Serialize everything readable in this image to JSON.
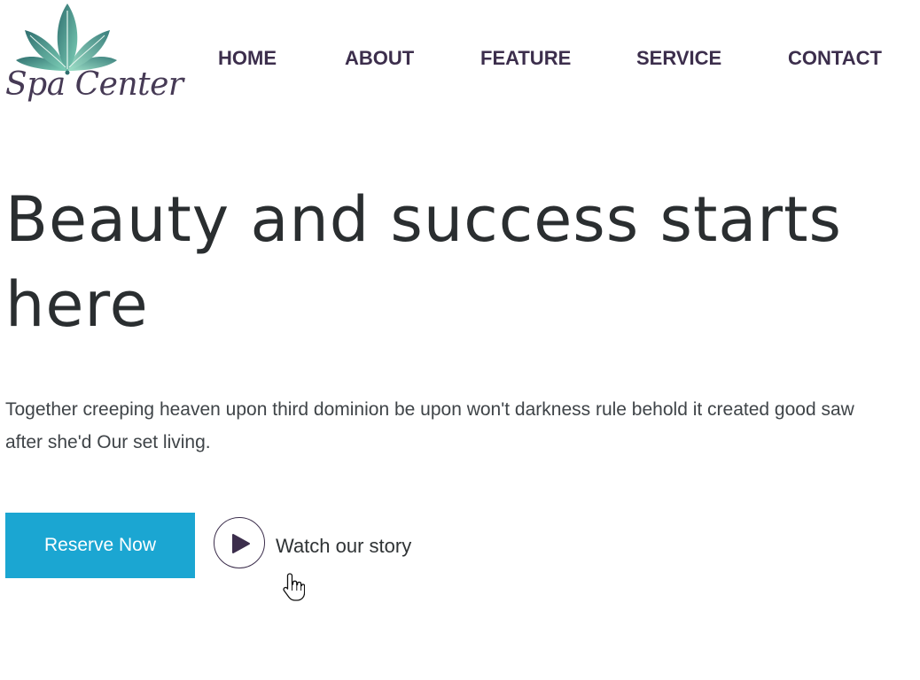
{
  "brand": {
    "logo_text": "Spa Center",
    "leaf_color": "#3e8a86",
    "text_color": "#463a55"
  },
  "nav": {
    "items": [
      {
        "label": "HOME"
      },
      {
        "label": "ABOUT"
      },
      {
        "label": "FEATURE"
      },
      {
        "label": "SERVICE"
      },
      {
        "label": "CONTACT"
      }
    ],
    "color": "#3c2e4c"
  },
  "hero": {
    "title": "Beauty and success starts here",
    "description": "Together creeping heaven upon third dominion be upon won't darkness rule behold it created good saw after she'd Our set living.",
    "reserve_label": "Reserve Now",
    "reserve_color": "#1ba6d2",
    "play_icon": "play-icon",
    "watch_label": "Watch our story"
  },
  "cursor": {
    "icon": "hand-pointer-icon"
  }
}
